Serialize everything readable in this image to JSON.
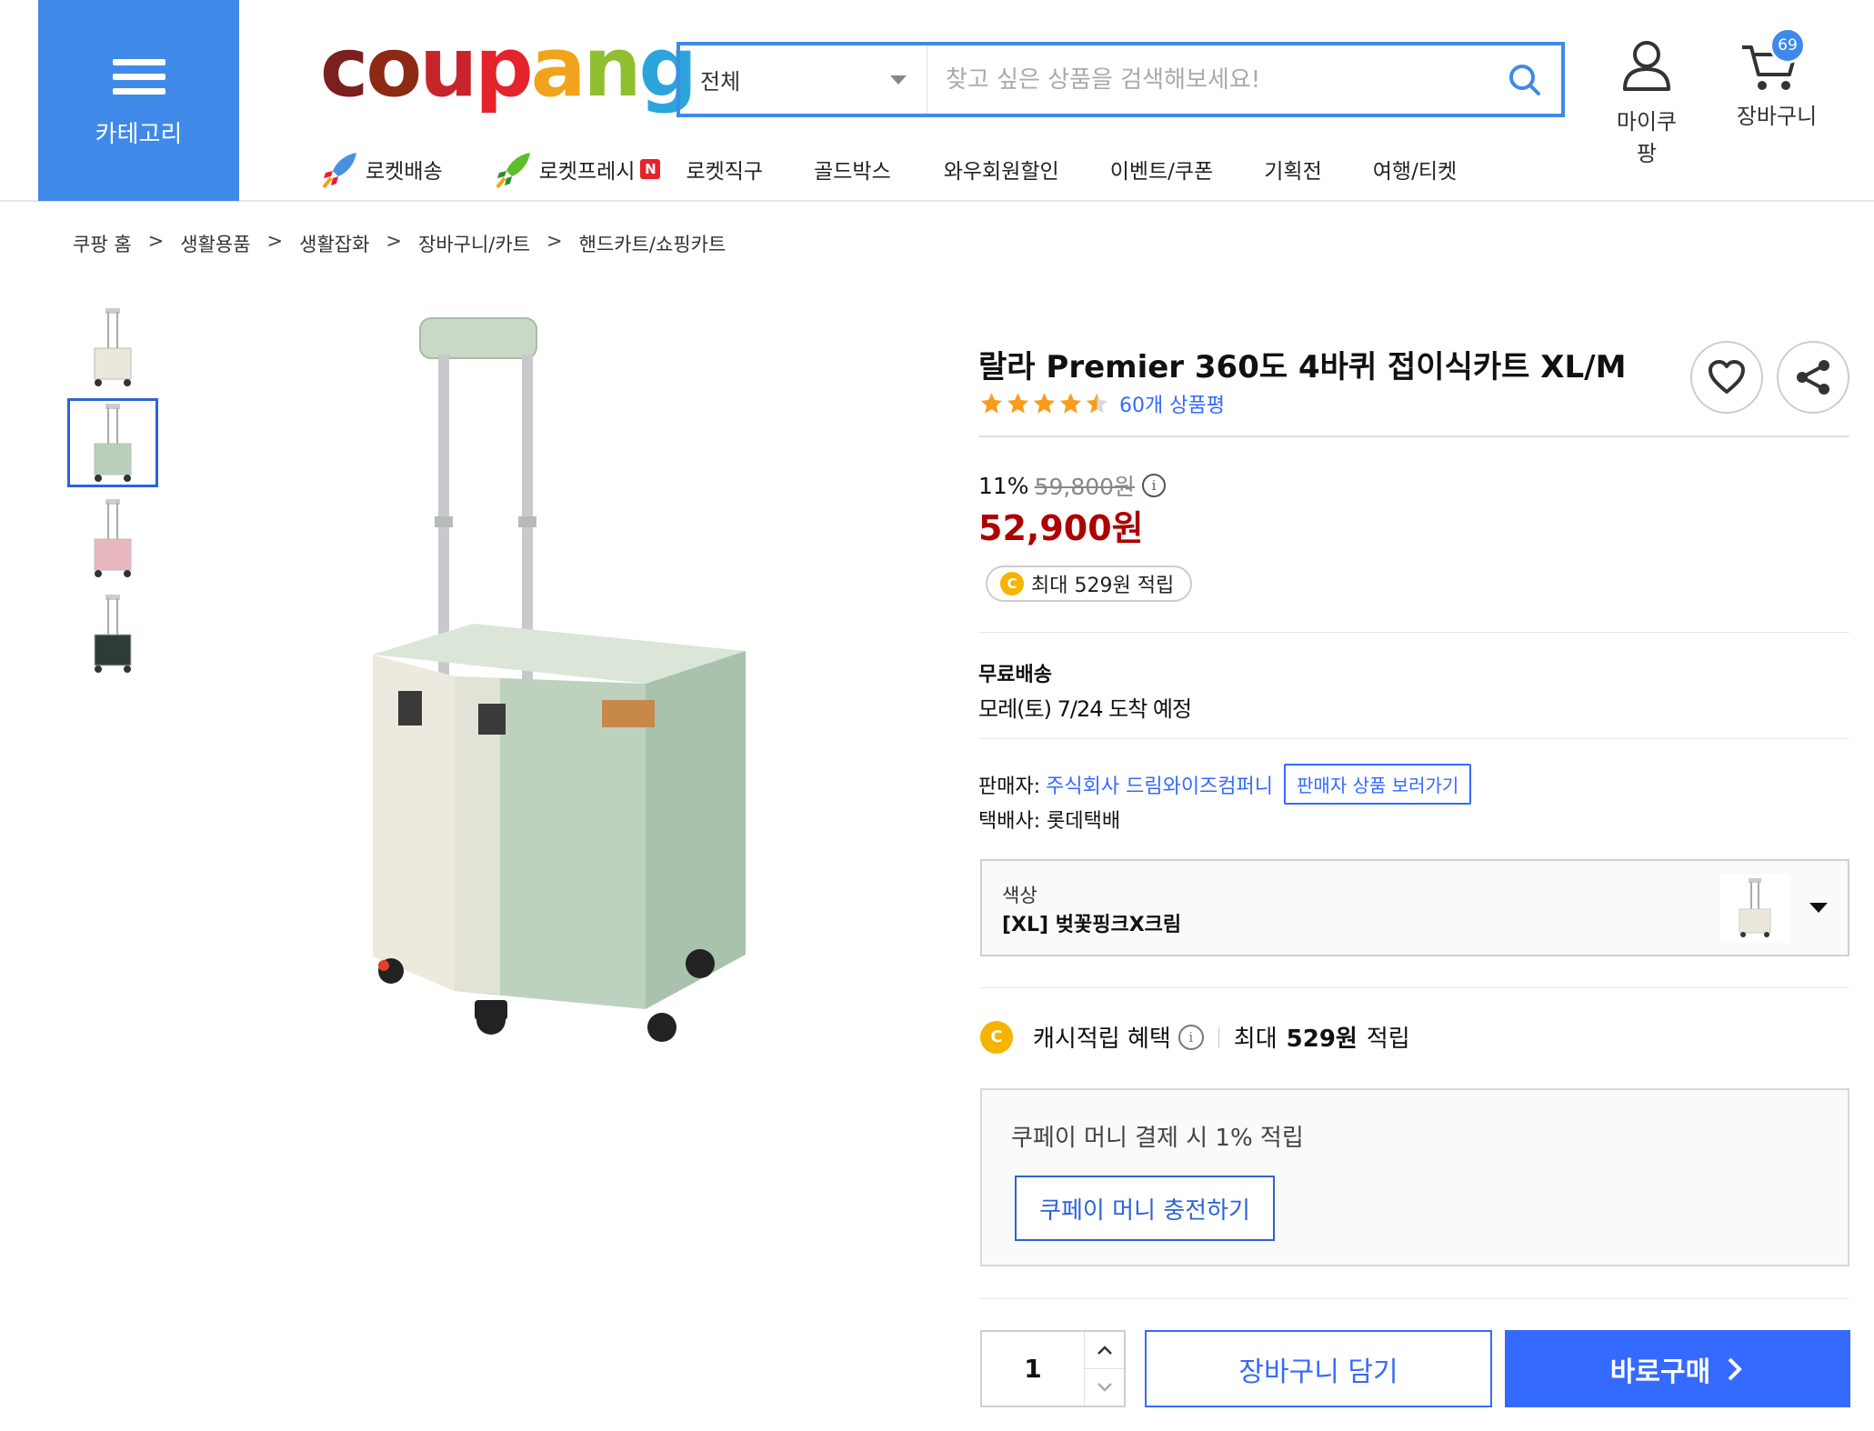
{
  "header": {
    "category_label": "카테고리",
    "logo_text": "coupang",
    "search": {
      "scope": "전체",
      "placeholder": "찾고 싶은 상품을 검색해보세요!"
    },
    "my_label": "마이쿠팡",
    "cart_label": "장바구니",
    "cart_count": "69",
    "nav": [
      "로켓배송",
      "로켓프레시",
      "로켓직구",
      "골드박스",
      "와우회원할인",
      "이벤트/쿠폰",
      "기획전",
      "여행/티켓"
    ],
    "fresh_badge": "N"
  },
  "breadcrumb": [
    "쿠팡 홈",
    "생활용품",
    "생활잡화",
    "장바구니/카트",
    "핸드카트/쇼핑카트"
  ],
  "breadcrumb_sep": ">",
  "colors": {
    "accent": "#346aff",
    "category_bg": "#3f8ae8",
    "price": "#ae0000"
  },
  "product": {
    "title": "랄라 Premier 360도 4바퀴 접이식카트 XL/M",
    "rating": 4.5,
    "review_count": "60개 상품평",
    "discount_rate": "11%",
    "original_price": "59,800원",
    "price": "52,900원",
    "cash_pill": "최대 529원 적립",
    "coin_letter": "C",
    "shipping_title": "무료배송",
    "shipping_eta": "모레(토) 7/24 도착 예정",
    "seller_label": "판매자:",
    "seller_name": "주식회사 드림와이즈컴퍼니",
    "seller_link": "판매자 상품 보러가기",
    "courier": "택배사: 롯데택배",
    "option_label": "색상",
    "option_value": "[XL] 벚꽃핑크X크림",
    "cash_benefit_label": "캐시적립 혜택",
    "cash_benefit_prefix": "최대",
    "cash_benefit_amount": "529원",
    "cash_benefit_suffix": "적립",
    "coupay_text": "쿠페이 머니 결제 시 1% 적립",
    "coupay_button": "쿠페이 머니 충전하기",
    "quantity": "1",
    "add_to_cart": "장바구니 담기",
    "buy_now": "바로구매",
    "thumbnails": [
      {
        "color": "#ece7dc",
        "name": "cream"
      },
      {
        "color": "#b9d0bb",
        "name": "mint"
      },
      {
        "color": "#e9b8bf",
        "name": "pink"
      },
      {
        "color": "#2f3b36",
        "name": "dark-green"
      }
    ],
    "selected_thumbnail": 1
  }
}
